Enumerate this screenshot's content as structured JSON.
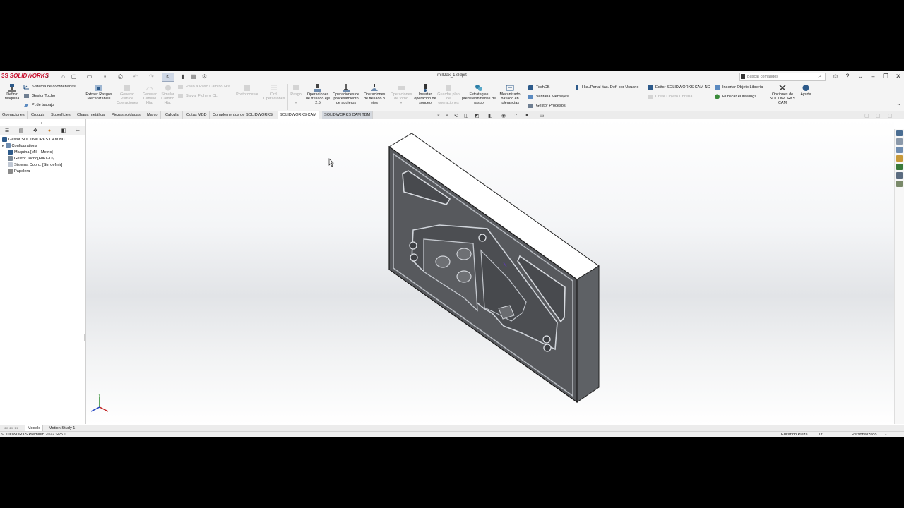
{
  "app": {
    "brand": "SOLIDWORKS",
    "doc_title": "mill2ax_1.sldprt"
  },
  "search": {
    "placeholder": "Buscar comandos"
  },
  "commands": {
    "definir_maquina": "Definir Máquina",
    "sistema_coord": "Sistema de coordenadas",
    "gestor_tocho": "Gestor Tocho",
    "pl_trabajo": "Pl.de trabajo",
    "extraer_rasgos": "Extraer Rasgos Mecanizables",
    "generar_plan": "Generar Plan de Operaciones",
    "generar_camino": "Generar Camino Hta.",
    "simular_camino": "Simular Camino Hta.",
    "paso_a_paso": "Paso a Paso Camino Hta.",
    "salvar_fichero": "Salvar Fichero CL",
    "postprocesar": "Postprocesar",
    "ord_operaciones": "Ord. Operaciones",
    "rasgo": "Rasgo",
    "op_fresado_25": "Operaciones de fresado eje 2,5",
    "op_agujeros": "Operaciones de procesamiento de agujeros",
    "op_fresado_3": "Operaciones de fresado 3 ejes",
    "op_torno": "Operaciones de torno",
    "insertar_sondeo": "Insertar operación de sondeo",
    "guardar_plan": "Guardar plan de operaciones",
    "estrategias": "Estrategias predeterminadas de rasgo",
    "mecanizado_tol": "Mecanizado basado en tolerancias",
    "techdb": "TechDB",
    "ventana_mensajes": "Ventana Mensajes",
    "gestor_procesos": "Gestor Procesos",
    "hta_portahtas": "Hta./PortaHtas. Def. por Usuario",
    "editor_cam": "Editor SOLIDWORKS CAM NC",
    "crear_objeto": "Crear Objeto Librería",
    "insertar_objeto": "Insertar Objeto Librería",
    "publicar_edrawings": "Publicar eDrawings",
    "opciones_cam": "Opciones de SOLIDWORKS CAM",
    "ayuda": "Ayuda"
  },
  "tabs": [
    "Operaciones",
    "Croquis",
    "Superficies",
    "Chapa metálica",
    "Piezas soldadas",
    "Marco",
    "Calcular",
    "Cotas MBD",
    "Complementos de SOLIDWORKS",
    "SOLIDWORKS CAM",
    "SOLIDWORKS CAM TBM"
  ],
  "tree": {
    "root": "Gestor SOLIDWORKS CAM NC",
    "items": [
      "Configurations",
      "Maquina [Mill - Metric]",
      "Gestor Tocho[6061-T6]",
      "Sistema Coord. [Sin definir]",
      "Papelera"
    ]
  },
  "bottom_tabs": [
    "Modelo",
    "Motion Study 1"
  ],
  "status": {
    "version": "SOLIDWORKS Premium 2022 SP5.0",
    "editing": "Editando Pieza",
    "units": "Personalizado"
  },
  "colors": {
    "brand_red": "#c8102e",
    "part_face": "#5a5c60",
    "part_top": "#ffffff"
  }
}
